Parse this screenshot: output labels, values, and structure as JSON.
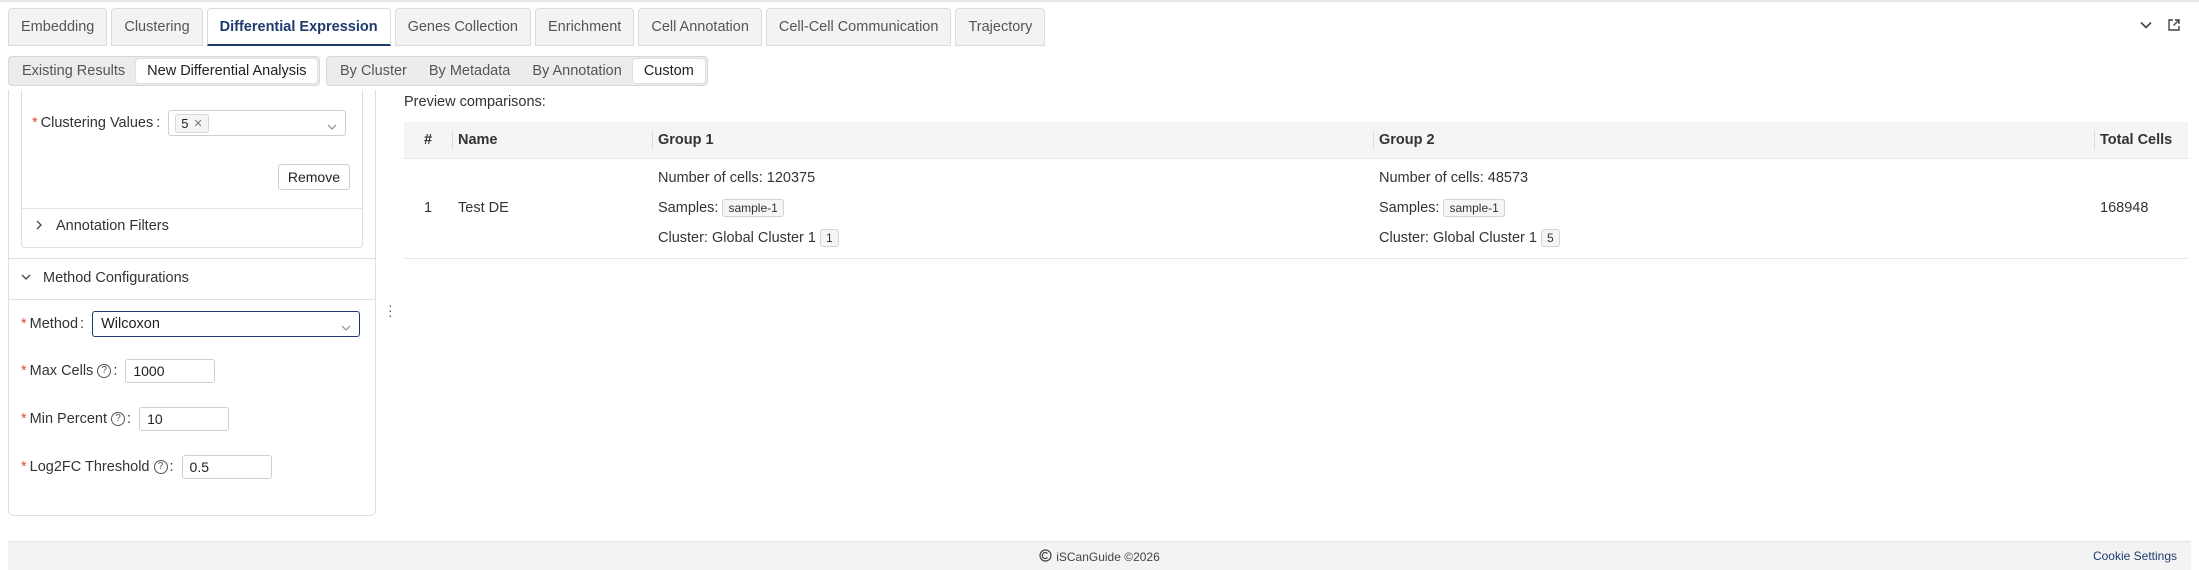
{
  "top_tabs": [
    "Embedding",
    "Clustering",
    "Differential Expression",
    "Genes Collection",
    "Enrichment",
    "Cell Annotation",
    "Cell-Cell Communication",
    "Trajectory"
  ],
  "active_top_tab": "Differential Expression",
  "mode_tabs": [
    "Existing Results",
    "New Differential Analysis"
  ],
  "active_mode_tab": "New Differential Analysis",
  "by_tabs": [
    "By Cluster",
    "By Metadata",
    "By Annotation",
    "Custom"
  ],
  "active_by_tab": "Custom",
  "left": {
    "clustering_values_label": "Clustering Values",
    "clustering_values_tag": "5",
    "remove_label": "Remove",
    "annotation_filters_label": "Annotation Filters",
    "method_config_label": "Method Configurations",
    "method_label": "Method",
    "method_value": "Wilcoxon",
    "max_cells_label": "Max Cells",
    "max_cells_value": "1000",
    "min_percent_label": "Min Percent",
    "min_percent_value": "10",
    "log2fc_label": "Log2FC Threshold",
    "log2fc_value": "0.5"
  },
  "preview": {
    "label": "Preview comparisons:",
    "columns": [
      "#",
      "Name",
      "Group 1",
      "Group 2",
      "Total Cells"
    ],
    "rows": [
      {
        "index": "1",
        "name": "Test DE",
        "group1": {
          "cells": "Number of cells: 120375",
          "samples_label": "Samples:",
          "sample_tag": "sample-1",
          "cluster_label": "Cluster: Global Cluster 1",
          "cluster_tag": "1"
        },
        "group2": {
          "cells": "Number of cells: 48573",
          "samples_label": "Samples:",
          "sample_tag": "sample-1",
          "cluster_label": "Cluster: Global Cluster 1",
          "cluster_tag": "5"
        },
        "total": "168948"
      }
    ]
  },
  "footer": {
    "brand": "iSCanGuide ©2026",
    "cookie": "Cookie Settings"
  }
}
